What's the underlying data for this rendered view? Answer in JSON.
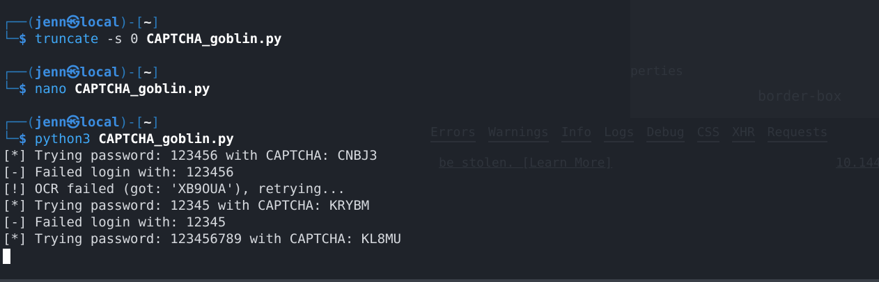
{
  "prompt": {
    "open": "┌──(",
    "user": "jenn",
    "at": "㉿",
    "host": "local",
    "mid": ")-[",
    "path": "~",
    "close": "]",
    "corner": "└─",
    "dollar": "$"
  },
  "commands": [
    {
      "cmd": "truncate",
      "args": " -s 0 ",
      "file": "CAPTCHA_goblin.py"
    },
    {
      "cmd": "nano",
      "args": " ",
      "file": "CAPTCHA_goblin.py"
    },
    {
      "cmd": "python3",
      "args": " ",
      "file": "CAPTCHA_goblin.py"
    }
  ],
  "output": [
    "[*] Trying password: 123456 with CAPTCHA: CNBJ3",
    "[-] Failed login with: 123456",
    "[!] OCR failed (got: 'XB9OUA'), retrying...",
    "[*] Trying password: 12345 with CAPTCHA: KRYBM",
    "[-] Failed login with: 12345",
    "[*] Trying password: 123456789 with CAPTCHA: KL8MU"
  ],
  "ghost": {
    "props": "perties",
    "bbox": "border-box",
    "tabs": [
      "Errors",
      "Warnings",
      "Info",
      "Logs",
      "Debug",
      "CSS",
      "XHR",
      "Requests"
    ],
    "learn": "be stolen. [Learn More]",
    "ip": "10.144."
  },
  "colors": {
    "background": "#1f232a",
    "prompt_blue": "#3b8de0",
    "command_blue": "#3fa7f5"
  }
}
